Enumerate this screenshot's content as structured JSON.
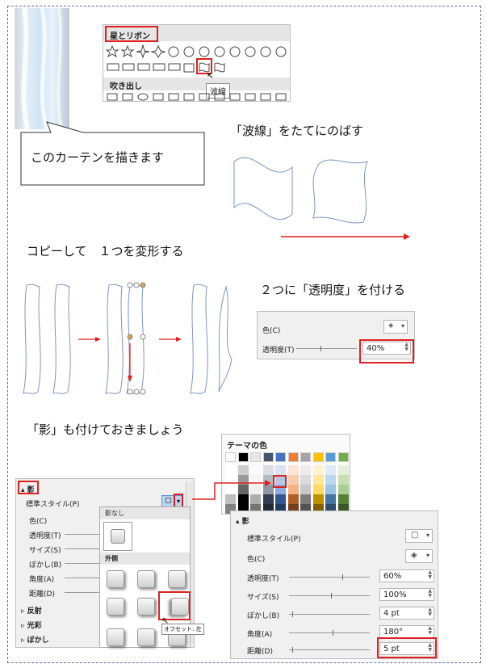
{
  "ribbon": {
    "shapes_title": "星とリボン",
    "callouts_title": "吹き出し",
    "tooltip": "波線"
  },
  "captions": {
    "curtain_bubble": "このカーテンを描きます",
    "stretch": "「波線」をたてにのばす",
    "copy": "コピーして　１つを変形する",
    "transparency": "２つに「透明度」を付ける",
    "shadow": "「影」も付けておきましょう"
  },
  "fill_panel": {
    "color_label": "色(C)",
    "transparency_label": "透明度(T)",
    "transparency_value": "40%"
  },
  "theme_colors": {
    "title": "テーマの色",
    "top_row": [
      "#ffffff",
      "#000000",
      "#e7e6e6",
      "#44546a",
      "#4472c4",
      "#ed7d31",
      "#a5a5a5",
      "#ffc000",
      "#5b9bd5",
      "#70ad47"
    ]
  },
  "shadow_left": {
    "section": "影",
    "preset_label": "標準スタイル(P)",
    "color_label": "色(C)",
    "transparency_label": "透明度(T)",
    "size_label": "サイズ(S)",
    "blur_label": "ぼかし(B)",
    "angle_label": "角度(A)",
    "distance_label": "距離(D)",
    "reflection": "反射",
    "glow": "光彩",
    "soft_edges": "ぼかし",
    "no_shadow": "影なし",
    "outer": "外側",
    "offset_tooltip": "オフセット: 左"
  },
  "shadow_right": {
    "section": "影",
    "preset_label": "標準スタイル(P)",
    "color_label": "色(C)",
    "transparency_label": "透明度(T)",
    "transparency_value": "60%",
    "size_label": "サイズ(S)",
    "size_value": "100%",
    "blur_label": "ぼかし(B)",
    "blur_value": "4 pt",
    "angle_label": "角度(A)",
    "angle_value": "180°",
    "distance_label": "距離(D)",
    "distance_value": "5 pt"
  }
}
